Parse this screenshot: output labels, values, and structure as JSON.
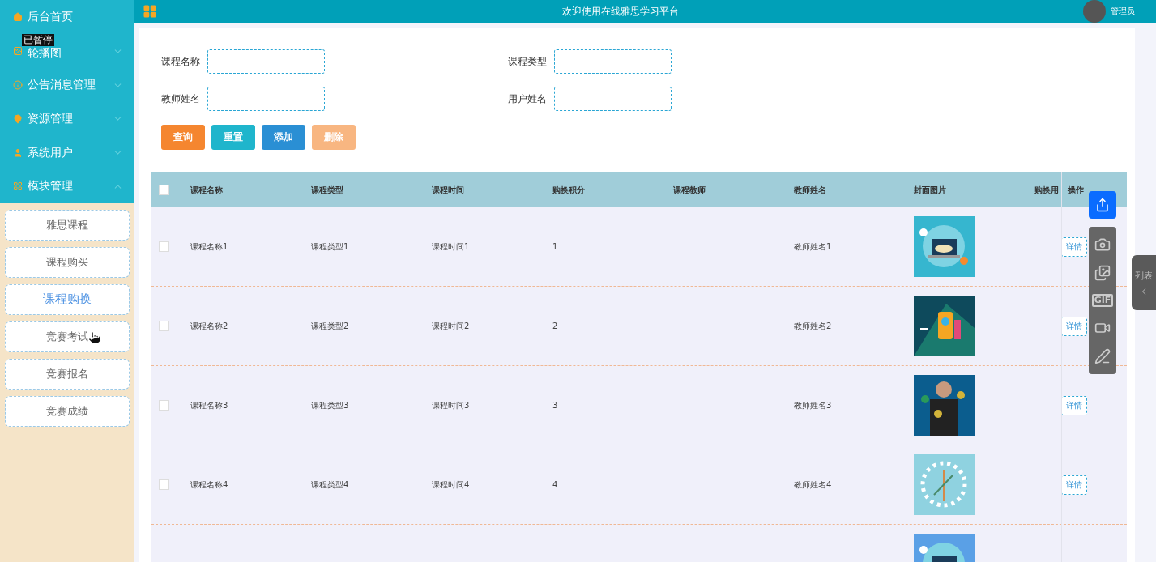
{
  "sidebar": {
    "items": [
      {
        "label": "后台首页"
      },
      {
        "label": "轮播图",
        "expanded": false
      },
      {
        "label": "公告消息管理",
        "expanded": false
      },
      {
        "label": "资源管理",
        "expanded": false
      },
      {
        "label": "系统用户",
        "expanded": false
      },
      {
        "label": "模块管理",
        "expanded": true,
        "children": [
          {
            "label": "雅思课程",
            "selected": false
          },
          {
            "label": "课程购买",
            "selected": false
          },
          {
            "label": "课程购换",
            "selected": true
          },
          {
            "label": "竞赛考试",
            "selected": false
          },
          {
            "label": "竞赛报名",
            "selected": false
          },
          {
            "label": "竞赛成绩",
            "selected": false
          }
        ]
      }
    ]
  },
  "paused_label": "已暂停",
  "header": {
    "title": "欢迎使用在线雅思学习平台",
    "user": "管理员"
  },
  "search": {
    "fields": [
      {
        "label": "课程名称"
      },
      {
        "label": "课程类型"
      },
      {
        "label": "教师姓名"
      },
      {
        "label": "用户姓名"
      }
    ],
    "buttons": [
      {
        "label": "查询",
        "kind": "query",
        "disabled": false
      },
      {
        "label": "重置",
        "kind": "reset",
        "disabled": false
      },
      {
        "label": "添加",
        "kind": "add",
        "disabled": false
      },
      {
        "label": "删除",
        "kind": "delete",
        "disabled": true
      }
    ]
  },
  "table": {
    "all_checked": false,
    "columns": [
      "课程名称",
      "课程类型",
      "课程时间",
      "购换积分",
      "课程教师",
      "教师姓名",
      "封面图片",
      "购换用",
      "操作"
    ],
    "rows": [
      {
        "checked": false,
        "cells": [
          "课程名称1",
          "课程类型1",
          "课程时间1",
          "1",
          "",
          "教师姓名1"
        ],
        "action": "详情"
      },
      {
        "checked": false,
        "cells": [
          "课程名称2",
          "课程类型2",
          "课程时间2",
          "2",
          "",
          "教师姓名2"
        ],
        "action": "详情"
      },
      {
        "checked": false,
        "cells": [
          "课程名称3",
          "课程类型3",
          "课程时间3",
          "3",
          "",
          "教师姓名3"
        ],
        "action": "详情"
      },
      {
        "checked": false,
        "cells": [
          "课程名称4",
          "课程类型4",
          "课程时间4",
          "4",
          "",
          "教师姓名4"
        ],
        "action": "详情"
      },
      {
        "cells": []
      }
    ]
  },
  "recorder": {
    "gif_label": "GIF",
    "list_tab": "列表"
  }
}
